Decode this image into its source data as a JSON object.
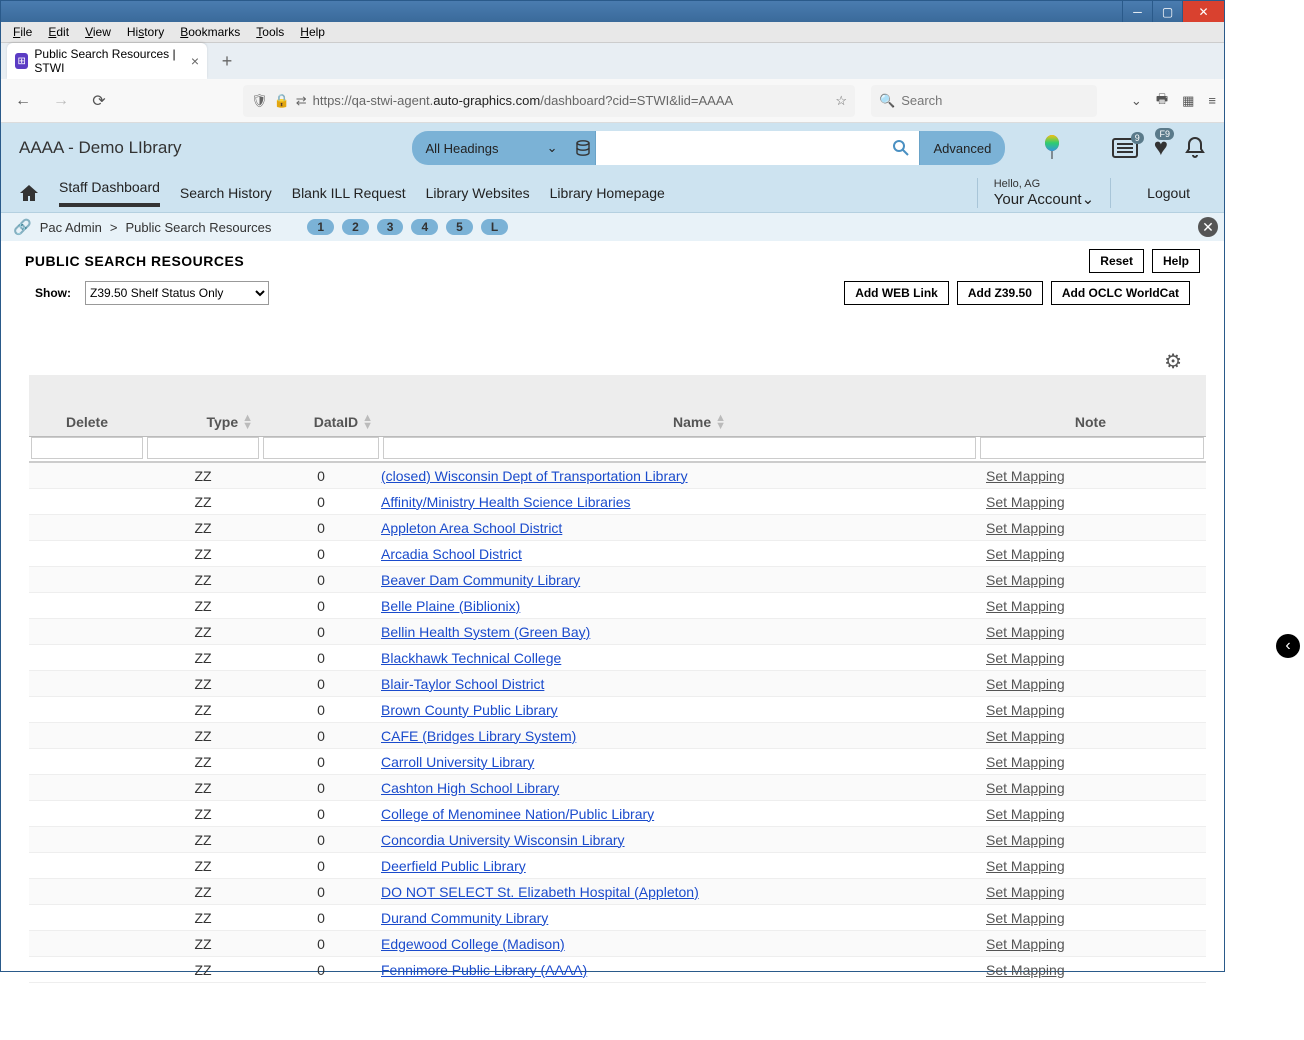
{
  "browser": {
    "menus": [
      "File",
      "Edit",
      "View",
      "History",
      "Bookmarks",
      "Tools",
      "Help"
    ],
    "tab_title": "Public Search Resources | STWI",
    "url_prefix": "https://qa-stwi-agent.",
    "url_domain": "auto-graphics.com",
    "url_path": "/dashboard?cid=STWI&lid=AAAA",
    "search_placeholder": "Search"
  },
  "header": {
    "library_name": "AAAA - Demo LIbrary",
    "index_label": "All Headings",
    "advanced": "Advanced",
    "news_badge": "9",
    "fav_badge": "F9"
  },
  "nav": {
    "items": [
      "Staff Dashboard",
      "Search History",
      "Blank ILL Request",
      "Library Websites",
      "Library Homepage"
    ],
    "hello": "Hello, AG",
    "your_account": "Your Account",
    "logout": "Logout"
  },
  "breadcrumb": {
    "root": "Pac Admin",
    "current": "Public Search Resources",
    "pages": [
      "1",
      "2",
      "3",
      "4",
      "5",
      "L"
    ]
  },
  "page": {
    "title": "PUBLIC SEARCH RESOURCES",
    "reset": "Reset",
    "help": "Help",
    "show_label": "Show:",
    "show_value": "Z39.50 Shelf Status Only",
    "add_web": "Add WEB Link",
    "add_z3950": "Add Z39.50",
    "add_oclc": "Add OCLC WorldCat"
  },
  "table": {
    "headers": {
      "delete": "Delete",
      "type": "Type",
      "dataid": "DataID",
      "name": "Name",
      "note": "Note"
    },
    "set_mapping": "Set Mapping",
    "rows": [
      {
        "type": "ZZ",
        "dataid": "0",
        "name": "(closed) Wisconsin Dept of Transportation Library"
      },
      {
        "type": "ZZ",
        "dataid": "0",
        "name": "Affinity/Ministry Health Science Libraries"
      },
      {
        "type": "ZZ",
        "dataid": "0",
        "name": "Appleton Area School District"
      },
      {
        "type": "ZZ",
        "dataid": "0",
        "name": "Arcadia School District"
      },
      {
        "type": "ZZ",
        "dataid": "0",
        "name": "Beaver Dam Community Library"
      },
      {
        "type": "ZZ",
        "dataid": "0",
        "name": "Belle Plaine (Biblionix)"
      },
      {
        "type": "ZZ",
        "dataid": "0",
        "name": "Bellin Health System (Green Bay)"
      },
      {
        "type": "ZZ",
        "dataid": "0",
        "name": "Blackhawk Technical College"
      },
      {
        "type": "ZZ",
        "dataid": "0",
        "name": "Blair-Taylor School District"
      },
      {
        "type": "ZZ",
        "dataid": "0",
        "name": "Brown County Public Library"
      },
      {
        "type": "ZZ",
        "dataid": "0",
        "name": "CAFE (Bridges Library System)"
      },
      {
        "type": "ZZ",
        "dataid": "0",
        "name": "Carroll University Library"
      },
      {
        "type": "ZZ",
        "dataid": "0",
        "name": "Cashton High School Library"
      },
      {
        "type": "ZZ",
        "dataid": "0",
        "name": "College of Menominee Nation/Public Library"
      },
      {
        "type": "ZZ",
        "dataid": "0",
        "name": "Concordia University Wisconsin Library"
      },
      {
        "type": "ZZ",
        "dataid": "0",
        "name": "Deerfield Public Library"
      },
      {
        "type": "ZZ",
        "dataid": "0",
        "name": "DO NOT SELECT St. Elizabeth Hospital (Appleton)"
      },
      {
        "type": "ZZ",
        "dataid": "0",
        "name": "Durand Community Library"
      },
      {
        "type": "ZZ",
        "dataid": "0",
        "name": "Edgewood College (Madison)"
      },
      {
        "type": "ZZ",
        "dataid": "0",
        "name": "Fennimore Public Library (AAAA)"
      }
    ]
  }
}
